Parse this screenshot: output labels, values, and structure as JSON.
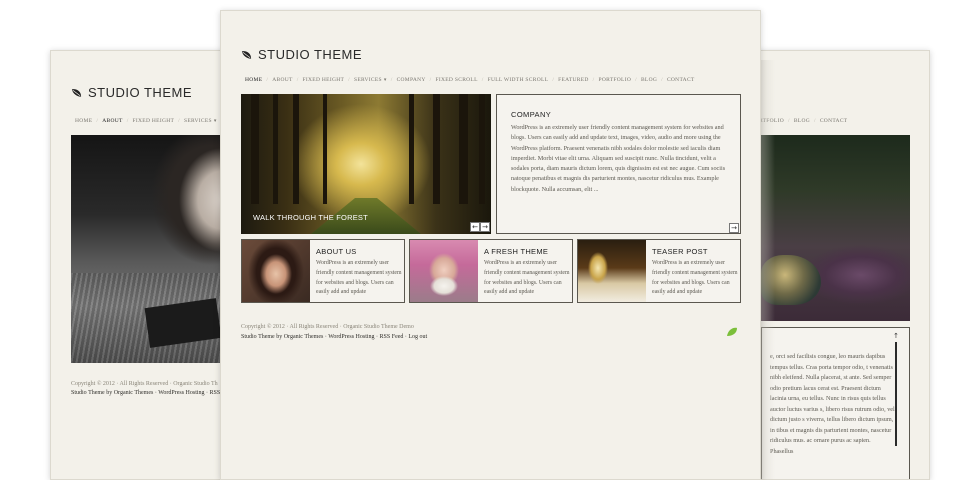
{
  "brand": "STUDIO THEME",
  "colors": {
    "paper": "#f3f1ea",
    "accent_green": "#7bbf3a",
    "border": "#5a574f"
  },
  "icons": {
    "logo": "leaf-icon",
    "prev": "arrow-left-icon",
    "next": "arrow-right-icon",
    "expand": "arrow-right-icon",
    "footer": "leaf-icon",
    "scroll": "arrow-up-icon"
  },
  "front": {
    "nav": [
      {
        "label": "HOME"
      },
      {
        "label": "ABOUT"
      },
      {
        "label": "FIXED HEIGHT"
      },
      {
        "label": "SERVICES"
      },
      {
        "label": "COMPANY"
      },
      {
        "label": "FIXED SCROLL"
      },
      {
        "label": "FULL WIDTH SCROLL"
      },
      {
        "label": "FEATURED"
      },
      {
        "label": "PORTFOLIO"
      },
      {
        "label": "BLOG"
      },
      {
        "label": "CONTACT"
      }
    ],
    "hero_caption": "WALK THROUGH THE FOREST",
    "company": {
      "heading": "COMPANY",
      "body": "WordPress is an extremely user friendly content management system for websites and blogs. Users can easily add and update text, images, video, audio and more using the WordPress platform. Praesent venenatis nibh sodales dolor molestie sed iaculis diam imperdiet. Morbi vitae elit urna. Aliquam sed suscipit nunc. Nulla tincidunt, velit a sodales porta, diam mauris dictum lorem, quis dignissim est est nec augue. Cum sociis natoque penatibus et magnis dis parturient montes, nascetur ridiculus mus. Example blockquote. Nulla accumsan, elit ..."
    },
    "teasers": [
      {
        "heading": "ABOUT US",
        "body": "WordPress is an extremely user friendly content management system for websites and blogs. Users can easily add and update"
      },
      {
        "heading": "A FRESH THEME",
        "body": "WordPress is an extremely user friendly content management system for websites and blogs. Users can easily add and update"
      },
      {
        "heading": "TEASER POST",
        "body": "WordPress is an extremely user friendly content management system for websites and blogs. Users can easily add and update"
      }
    ],
    "footer": {
      "copyright": "Copyright © 2012 · All Rights Reserved · Organic Studio Theme Demo",
      "links_line": "Studio Theme by Organic Themes · WordPress Hosting · RSS Feed · Log out"
    }
  },
  "left": {
    "nav": [
      {
        "label": "HOME"
      },
      {
        "label": "ABOUT"
      },
      {
        "label": "FIXED HEIGHT"
      },
      {
        "label": "SERVICES"
      }
    ],
    "footer": {
      "copyright": "Copyright © 2012 · All Rights Reserved · Organic Studio Th",
      "links_line": "Studio Theme by Organic Themes · WordPress Hosting · RSS"
    }
  },
  "right": {
    "nav": [
      {
        "label": "RTFOLIO"
      },
      {
        "label": "BLOG"
      },
      {
        "label": "CONTACT"
      }
    ],
    "text": "e, orci sed facilisis congue, leo mauris dapibus tempus tellus. Cras porta tempor odio, t venenatis nibh eleifend. Nulla placerat, st ante. Sed semper odio pretium lacus cerat est. Praesent dictum lacinia urna, eu tellus. Nunc in risus quis tellus auctor luctus varius s, libero risus rutrum odio, vel dictum justo s viverra, tellus libero dictum ipsum, in tibus et magnis dis parturient montes, nascetur ridiculus mus. ac ornare purus ac sapien. Phasellus"
  }
}
